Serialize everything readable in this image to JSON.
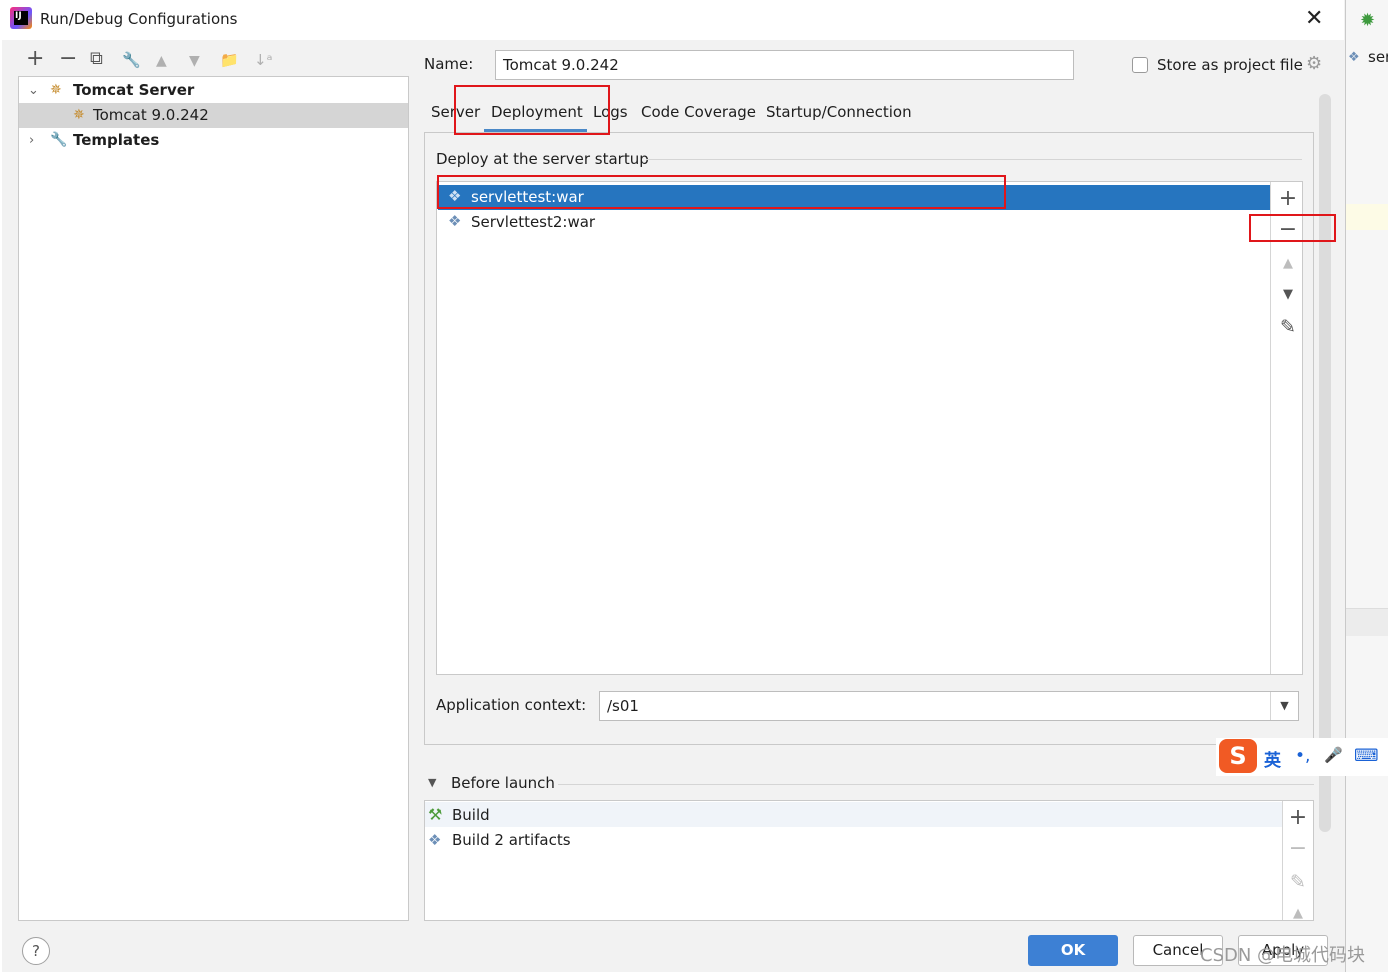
{
  "window": {
    "title": "Run/Debug Configurations",
    "close_glyph": "✕"
  },
  "toolbar": {
    "add": "+",
    "remove": "−",
    "copy": "⧉",
    "edit": "🔧",
    "up": "▲",
    "down": "▼",
    "folder": "📁",
    "sort": "↓ᵃ"
  },
  "tree": {
    "group_label": "Tomcat Server",
    "config_label": "Tomcat 9.0.242",
    "templates_label": "Templates"
  },
  "name_field": {
    "label": "Name:",
    "value": "Tomcat 9.0.242"
  },
  "store_as_project_file": {
    "label": "Store as project file",
    "checked": false
  },
  "tabs": [
    {
      "label": "Server"
    },
    {
      "label": "Deployment",
      "active": true
    },
    {
      "label": "Logs"
    },
    {
      "label": "Code Coverage"
    },
    {
      "label": "Startup/Connection"
    }
  ],
  "deployment": {
    "section_label": "Deploy at the server startup",
    "items": [
      {
        "label": "servlettest:war",
        "selected": true
      },
      {
        "label": "Servlettest2:war",
        "selected": false
      }
    ],
    "side_buttons": {
      "add": "+",
      "remove": "−",
      "up": "▲",
      "down": "▼",
      "edit": "✎"
    }
  },
  "application_context": {
    "label": "Application context:",
    "value": "/s01"
  },
  "before_launch": {
    "label": "Before launch",
    "items": [
      {
        "label": "Build"
      },
      {
        "label": "Build 2 artifacts"
      }
    ],
    "side_buttons": {
      "add": "+",
      "remove": "−",
      "edit": "✎",
      "up": "▲"
    }
  },
  "buttons": {
    "help": "?",
    "ok": "OK",
    "cancel": "Cancel",
    "apply": "Apply"
  },
  "ime_toolbar": {
    "logo": "S",
    "lang": "英",
    "punct": "•,",
    "mic": "🎤",
    "keyboard": "⌨"
  },
  "watermark": "CSDN @电城代码块",
  "background_right": {
    "snippet": "ser"
  },
  "colors": {
    "accent": "#2675bf",
    "ok_button": "#3d80d4",
    "tab_underline": "#4a88c7",
    "annotation_red": "#e0161a"
  }
}
